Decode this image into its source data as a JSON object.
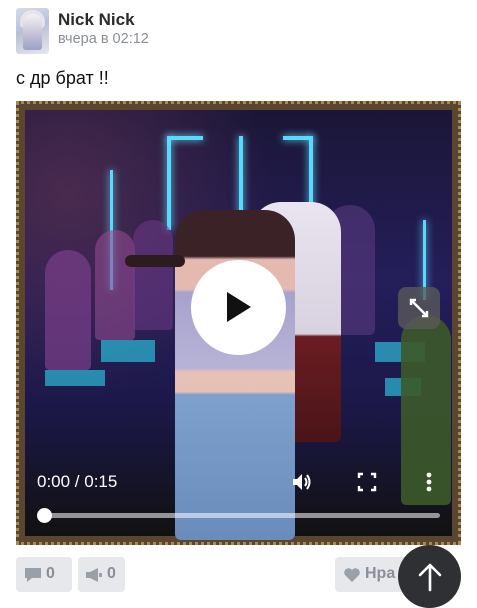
{
  "post": {
    "author": "Nick Nick",
    "time": "вчера в 02:12",
    "text": "с др брат !!"
  },
  "video": {
    "time_display": "0:00 / 0:15",
    "progress": 0.0
  },
  "actions": {
    "comments_count": "0",
    "reposts_count": "0",
    "like_label": "Нра"
  },
  "icons": [
    "play-icon",
    "expand-icon",
    "volume-icon",
    "fullscreen-icon",
    "more-icon",
    "comment-icon",
    "repost-icon",
    "heart-icon",
    "arrow-up-icon"
  ]
}
